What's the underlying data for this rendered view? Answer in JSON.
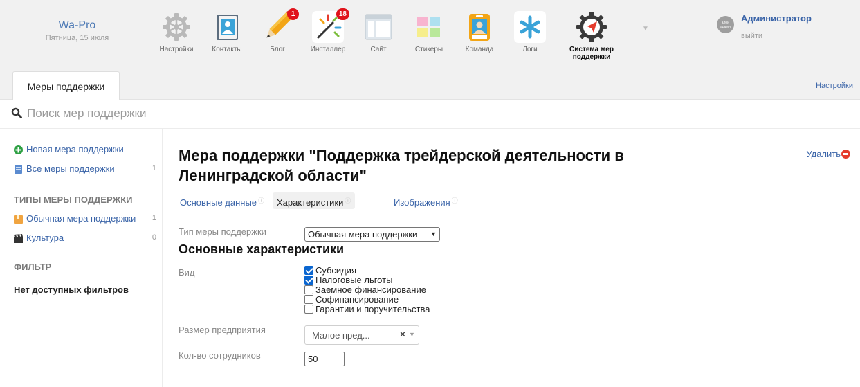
{
  "brand": {
    "name": "Wa-Pro",
    "date": "Пятница, 15 июля"
  },
  "apps": [
    {
      "label": "Настройки",
      "icon": "gear-icon",
      "badge": ""
    },
    {
      "label": "Контакты",
      "icon": "contact-book-icon",
      "badge": ""
    },
    {
      "label": "Блог",
      "icon": "pencil-icon",
      "badge": "1"
    },
    {
      "label": "Инсталлер",
      "icon": "installer-sparkle-icon",
      "badge": "18"
    },
    {
      "label": "Сайт",
      "icon": "site-window-icon",
      "badge": ""
    },
    {
      "label": "Стикеры",
      "icon": "stickers-icon",
      "badge": ""
    },
    {
      "label": "Команда",
      "icon": "team-badge-icon",
      "badge": ""
    },
    {
      "label": "Логи",
      "icon": "asterisk-icon",
      "badge": ""
    },
    {
      "label": "Система мер поддержки",
      "icon": "navigation-gear-icon",
      "badge": ""
    }
  ],
  "user": {
    "avatar_text": "злой админ",
    "name": "Администратор",
    "logout": "выйти"
  },
  "tabs": {
    "main": "Меры поддержки",
    "settings": "Настройки"
  },
  "search": {
    "placeholder": "Поиск мер поддержки"
  },
  "sidebar": {
    "new_item": "Новая мера поддержки",
    "all_items": {
      "label": "Все меры поддержки",
      "count": "1"
    },
    "types_heading": "ТИПЫ МЕРЫ ПОДДЕРЖКИ",
    "types": [
      {
        "label": "Обычная мера поддержки",
        "count": "1"
      },
      {
        "label": "Культура",
        "count": "0"
      }
    ],
    "filter_heading": "ФИЛЬТР",
    "filter_empty": "Нет доступных фильтров"
  },
  "main": {
    "title": "Мера поддержки \"Поддержка трейдерской деятельности в Ленинградской области\"",
    "delete_label": "Удалить",
    "subtabs": [
      "Основные данные",
      "Характеристики",
      "Изображения"
    ],
    "active_subtab": "Характеристики",
    "type_label": "Тип меры поддержки",
    "type_value": "Обычная мера поддержки",
    "section_title": "Основные характеристики",
    "kind_label": "Вид",
    "kinds": [
      {
        "label": "Субсидия",
        "checked": true
      },
      {
        "label": "Налоговые льготы",
        "checked": true
      },
      {
        "label": "Заемное финансирование",
        "checked": false
      },
      {
        "label": "Софинансирование",
        "checked": false
      },
      {
        "label": "Гарантии и поручительства",
        "checked": false
      }
    ],
    "size_label": "Размер предприятия",
    "size_value": "Малое пред...",
    "employees_label": "Кол-во сотрудников",
    "employees_value": "50"
  }
}
